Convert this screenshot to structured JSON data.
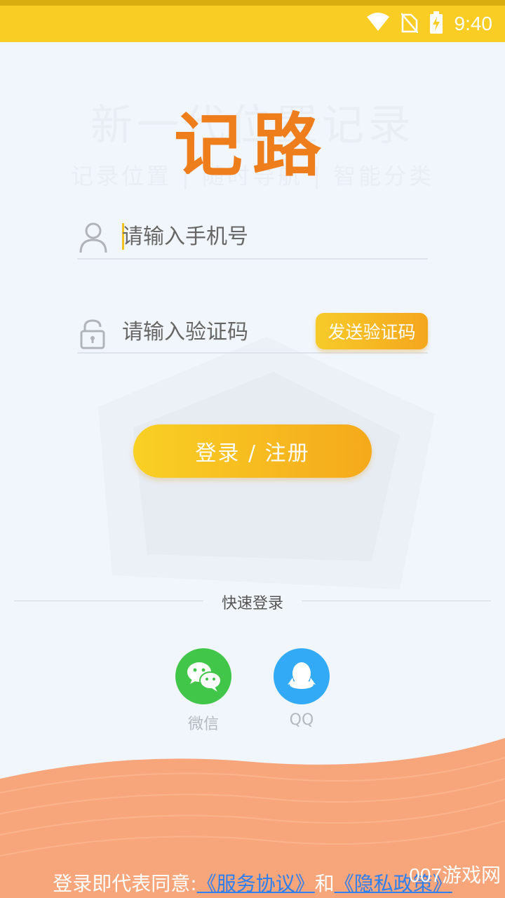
{
  "status_bar": {
    "time": "9:40"
  },
  "background_slogan": {
    "line1": "新一代位置记录",
    "line2": "记录位置 | 随时导航 | 智能分类"
  },
  "logo": {
    "text": "记路"
  },
  "phone_field": {
    "placeholder": "请输入手机号",
    "value": ""
  },
  "code_field": {
    "placeholder": "请输入验证码",
    "value": ""
  },
  "send_code_button": {
    "label": "发送验证码"
  },
  "login_button": {
    "label": "登录 / 注册"
  },
  "quick_login": {
    "title": "快速登录",
    "options": [
      {
        "label": "微信",
        "icon": "wechat-icon",
        "color": "#42c64a"
      },
      {
        "label": "QQ",
        "icon": "qq-icon",
        "color": "#33aaf5"
      }
    ]
  },
  "agreement": {
    "prefix": "登录即代表同意:",
    "service_link": "《服务协议》",
    "and": "和",
    "privacy_link": "《隐私政策》"
  },
  "watermark": "007游戏网",
  "colors": {
    "accent": "#f9cd23",
    "button_gradient_start": "#f9d024",
    "button_gradient_end": "#f5a91c",
    "wave": "#f7a57a",
    "link": "#2d7ff0"
  }
}
